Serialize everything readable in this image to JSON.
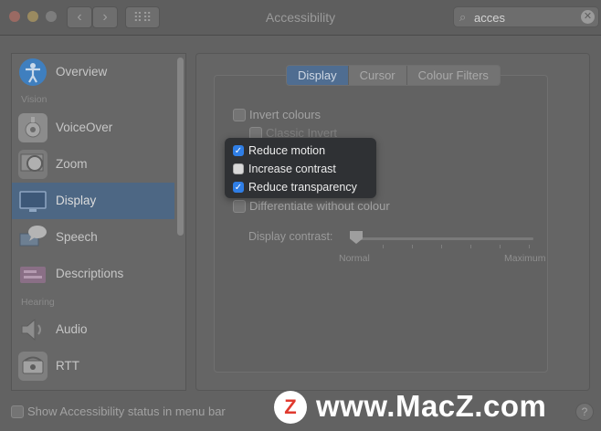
{
  "window": {
    "title": "Accessibility"
  },
  "search": {
    "value": "acces",
    "icon": "search-icon"
  },
  "sidebar": {
    "sections": {
      "vision": "Vision",
      "hearing": "Hearing"
    },
    "items": [
      {
        "label": "Overview",
        "icon": "accessibility-icon",
        "color": "#3f7fbf"
      },
      {
        "label": "VoiceOver",
        "icon": "voiceover-icon",
        "color": "#8a8a8a"
      },
      {
        "label": "Zoom",
        "icon": "zoom-icon",
        "color": "#7a7a7a"
      },
      {
        "label": "Display",
        "icon": "display-icon",
        "color": "#4a6f93"
      },
      {
        "label": "Speech",
        "icon": "speech-icon",
        "color": "#6f7d8c"
      },
      {
        "label": "Descriptions",
        "icon": "descriptions-icon",
        "color": "#8a6f86"
      },
      {
        "label": "Audio",
        "icon": "speaker-icon",
        "color": "#7f7f7f"
      },
      {
        "label": "RTT",
        "icon": "rtt-icon",
        "color": "#7d7d7d"
      }
    ],
    "selected": "Display"
  },
  "tabs": [
    {
      "label": "Display",
      "active": true
    },
    {
      "label": "Cursor",
      "active": false
    },
    {
      "label": "Colour Filters",
      "active": false
    }
  ],
  "options": {
    "invert_colours": {
      "label": "Invert colours",
      "checked": false
    },
    "classic_invert": {
      "label": "Classic Invert",
      "checked": false
    },
    "differentiate": {
      "label": "Differentiate without colour",
      "checked": false
    }
  },
  "popup": [
    {
      "label": "Reduce motion",
      "checked": true
    },
    {
      "label": "Increase contrast",
      "checked": false
    },
    {
      "label": "Reduce transparency",
      "checked": true
    }
  ],
  "contrast": {
    "label": "Display contrast:",
    "min_label": "Normal",
    "max_label": "Maximum",
    "value_fraction": 0.0
  },
  "status_bar": {
    "label": "Show Accessibility status in menu bar",
    "checked": false
  },
  "help": {
    "label": "?"
  },
  "watermark": {
    "badge": "Z",
    "text": "www.MacZ.com"
  },
  "colors": {
    "accent": "#2f7ee6",
    "selection": "#4d6784"
  }
}
